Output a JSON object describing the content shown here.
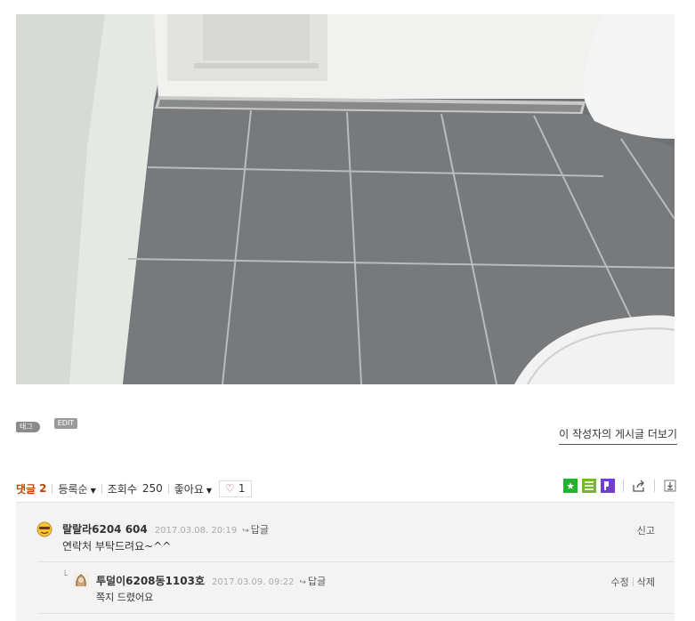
{
  "post": {
    "tag_chip": "태그",
    "edit_chip": "EDIT",
    "more_posts_link": "이 작성자의 게시글 더보기"
  },
  "comment_bar": {
    "label": "댓글",
    "count": "2",
    "sort_label": "등록순",
    "views_label": "조회수",
    "views_count": "250",
    "like_label": "좋아요",
    "like_count": "1"
  },
  "share_icons": [
    "star-icon",
    "list-icon",
    "bookmark-icon",
    "share-icon",
    "save-icon"
  ],
  "comments": [
    {
      "nickname": "랄랄라6204 604",
      "date": "2017.03.08. 20:19",
      "reply_label": "답글",
      "text": "연락처 부탁드려요~^^",
      "actions": [
        "신고"
      ]
    },
    {
      "nickname": "투덜이6208동1103호",
      "date": "2017.03.09. 09:22",
      "reply_label": "답글",
      "text": "쪽지 드렸어요",
      "actions": [
        "수정",
        "삭제"
      ]
    }
  ],
  "colors": {
    "accent": "#c1440e",
    "heart": "#e0314b",
    "comment_bg": "#f3f3f3"
  }
}
